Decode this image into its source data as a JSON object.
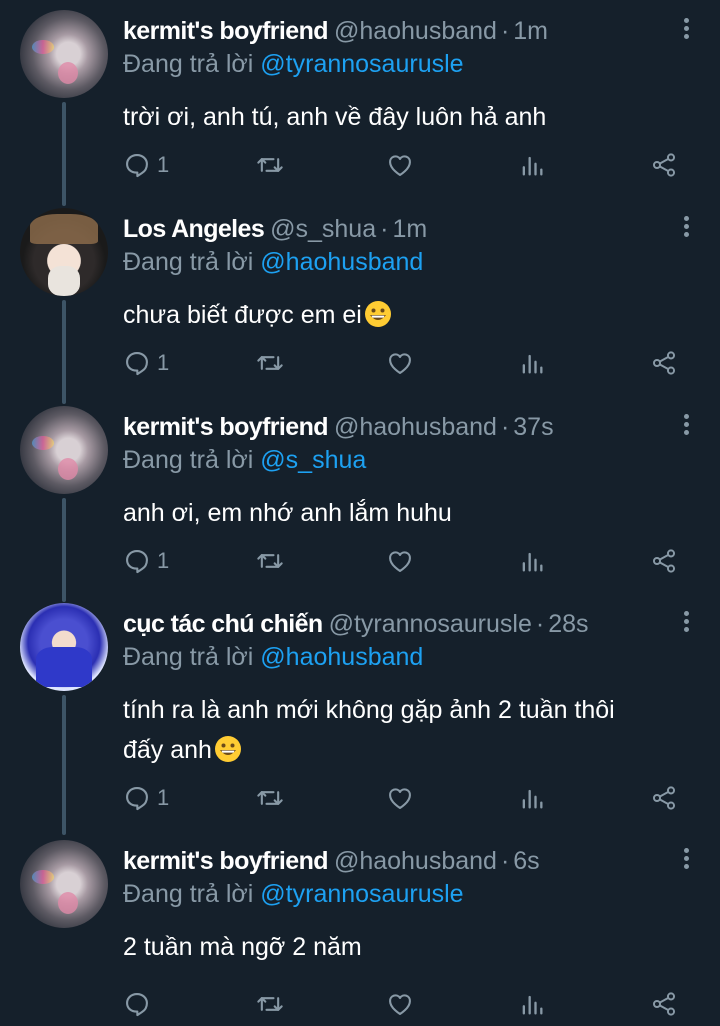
{
  "tweets": [
    {
      "name": "kermit's boyfriend",
      "handle": "@haohusband",
      "time": "1m",
      "replying_prefix": "Đang trả lời",
      "replying_to": "@tyrannosaurusle",
      "text": "trời ơi, anh tú, anh về đây luôn hả anh",
      "has_emoji": false,
      "reply_count": "1",
      "avatar": "frog"
    },
    {
      "name": "Los Angeles",
      "handle": "@s_shua",
      "time": "1m",
      "replying_prefix": "Đang trả lời",
      "replying_to": "@haohusband",
      "text": "chưa biết được em ei",
      "has_emoji": true,
      "reply_count": "1",
      "avatar": "la"
    },
    {
      "name": "kermit's boyfriend",
      "handle": "@haohusband",
      "time": "37s",
      "replying_prefix": "Đang trả lời",
      "replying_to": "@s_shua",
      "text": "anh ơi, em nhớ anh lắm huhu",
      "has_emoji": false,
      "reply_count": "1",
      "avatar": "frog"
    },
    {
      "name": "cục tác chú chiến",
      "handle": "@tyrannosaurusle",
      "time": "28s",
      "replying_prefix": "Đang trả lời",
      "replying_to": "@haohusband",
      "text_line1": "tính ra là anh mới không gặp ảnh 2 tuần thôi",
      "text_line2": "đấy anh",
      "has_emoji": true,
      "reply_count": "1",
      "avatar": "cuc"
    },
    {
      "name": "kermit's boyfriend",
      "handle": "@haohusband",
      "time": "6s",
      "replying_prefix": "Đang trả lời",
      "replying_to": "@tyrannosaurusle",
      "text": "2 tuần mà ngỡ 2 năm",
      "has_emoji": false,
      "reply_count": "",
      "avatar": "frog"
    }
  ],
  "separator": "·",
  "icons": {
    "reply": "reply-icon",
    "retweet": "retweet-icon",
    "like": "like-icon",
    "analytics": "analytics-icon",
    "share": "share-icon",
    "more": "more-vertical-icon",
    "emoji": "grinning-face-emoji"
  },
  "colors": {
    "background": "#15202b",
    "secondary_text": "#8899a6",
    "mention": "#1da1f2",
    "thread_line": "#3d5466"
  }
}
